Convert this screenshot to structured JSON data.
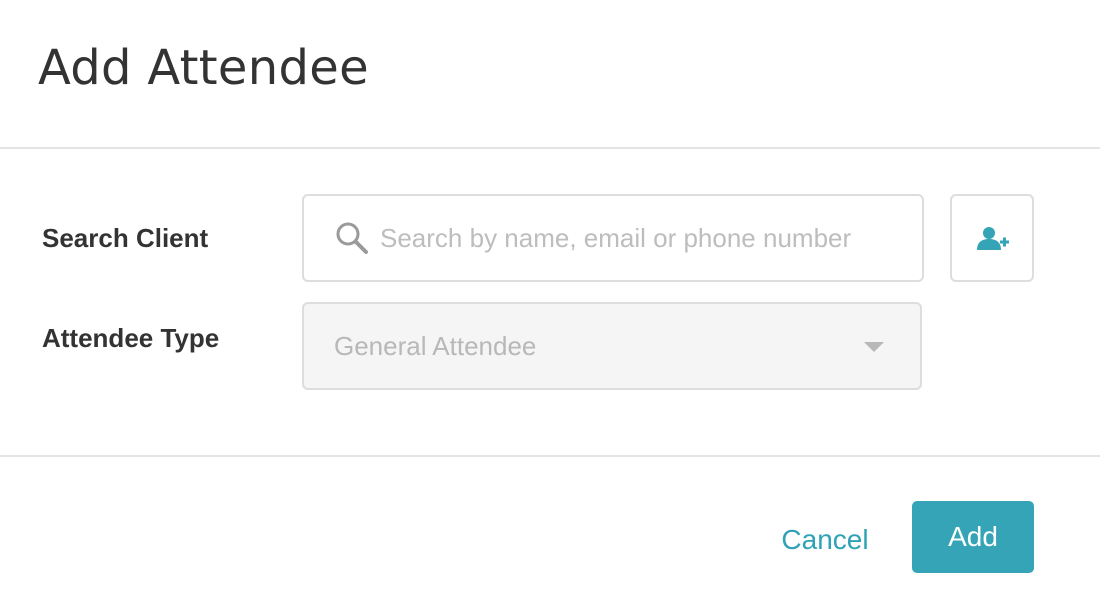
{
  "dialog": {
    "title": "Add Attendee"
  },
  "form": {
    "search_client": {
      "label": "Search Client",
      "placeholder": "Search by name, email or phone number",
      "value": ""
    },
    "attendee_type": {
      "label": "Attendee Type",
      "selected": "General Attendee",
      "disabled": true
    }
  },
  "footer": {
    "cancel_label": "Cancel",
    "add_label": "Add"
  },
  "icons": {
    "search": "search-icon",
    "add_client": "add-user-icon",
    "dropdown": "caret-down-icon"
  },
  "colors": {
    "accent": "#34a4b6",
    "link": "#2fa3b5",
    "title": "#333333",
    "placeholder": "#bdbdbd",
    "disabled_bg": "#f5f5f5",
    "border": "#dddddd"
  }
}
